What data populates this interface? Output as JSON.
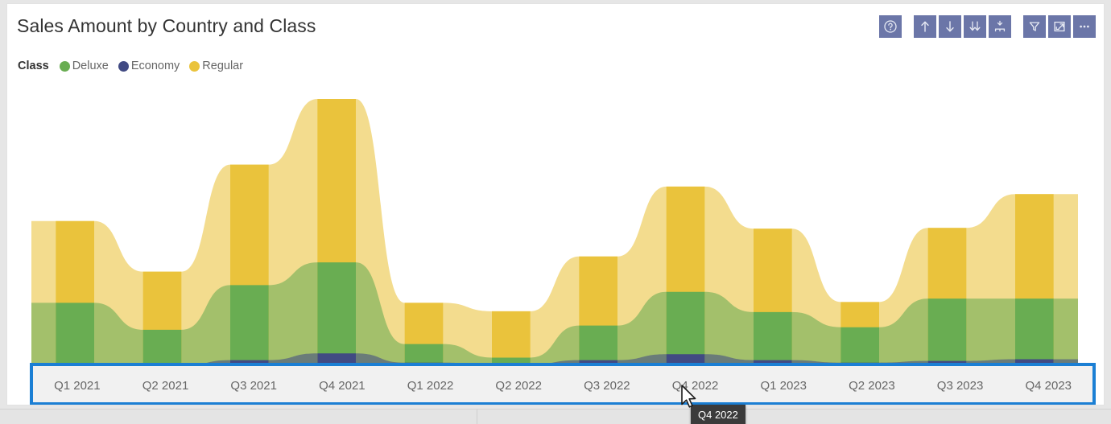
{
  "visual": {
    "title": "Sales Amount by Country and Class"
  },
  "legend": {
    "title": "Class",
    "items": [
      {
        "label": "Deluxe",
        "color": "#69ad52"
      },
      {
        "label": "Economy",
        "color": "#414a83"
      },
      {
        "label": "Regular",
        "color": "#eac33c"
      }
    ]
  },
  "toolbar": {
    "buttons": [
      {
        "name": "help-icon",
        "tooltip": "Help"
      },
      {
        "name": "drill-up-icon",
        "tooltip": "Drill up"
      },
      {
        "name": "drill-down-icon",
        "tooltip": "Drill down"
      },
      {
        "name": "expand-all-down-icon",
        "tooltip": "Expand all down one level in the hierarchy"
      },
      {
        "name": "drill-hierarchy-icon",
        "tooltip": "Go to the next level in the hierarchy"
      },
      {
        "name": "filter-icon",
        "tooltip": "Filters"
      },
      {
        "name": "focus-mode-icon",
        "tooltip": "Focus mode"
      },
      {
        "name": "more-options-icon",
        "tooltip": "More options"
      }
    ]
  },
  "tooltip": {
    "text": "Q4 2022"
  },
  "selection": {
    "border_color": "#1b7fd4",
    "background": "#f1f1f1"
  },
  "chart_data": {
    "type": "area",
    "title": "Sales Amount by Country and Class",
    "stacked": true,
    "smoothed": true,
    "xlabel": "",
    "ylabel": "",
    "grid": false,
    "legend_position": "top-left",
    "axis_max": 340,
    "categories": [
      "Q1 2021",
      "Q2 2021",
      "Q3 2021",
      "Q4 2021",
      "Q1 2022",
      "Q2 2022",
      "Q3 2022",
      "Q4 2022",
      "Q1 2023",
      "Q2 2023",
      "Q3 2023",
      "Q4 2023"
    ],
    "series": [
      {
        "name": "Economy",
        "color": "#414a83",
        "values": [
          2,
          2,
          9,
          17,
          6,
          4,
          9,
          16,
          9,
          6,
          8,
          10
        ]
      },
      {
        "name": "Deluxe",
        "color": "#69ad52",
        "values": [
          75,
          43,
          89,
          108,
          22,
          8,
          41,
          74,
          57,
          42,
          74,
          72
        ]
      },
      {
        "name": "Regular",
        "color": "#eac33c",
        "values": [
          97,
          69,
          143,
          194,
          49,
          55,
          82,
          125,
          99,
          30,
          84,
          124
        ]
      }
    ],
    "totals": [
      174,
      114,
      241,
      319,
      77,
      67,
      132,
      215,
      165,
      78,
      166,
      206
    ]
  }
}
